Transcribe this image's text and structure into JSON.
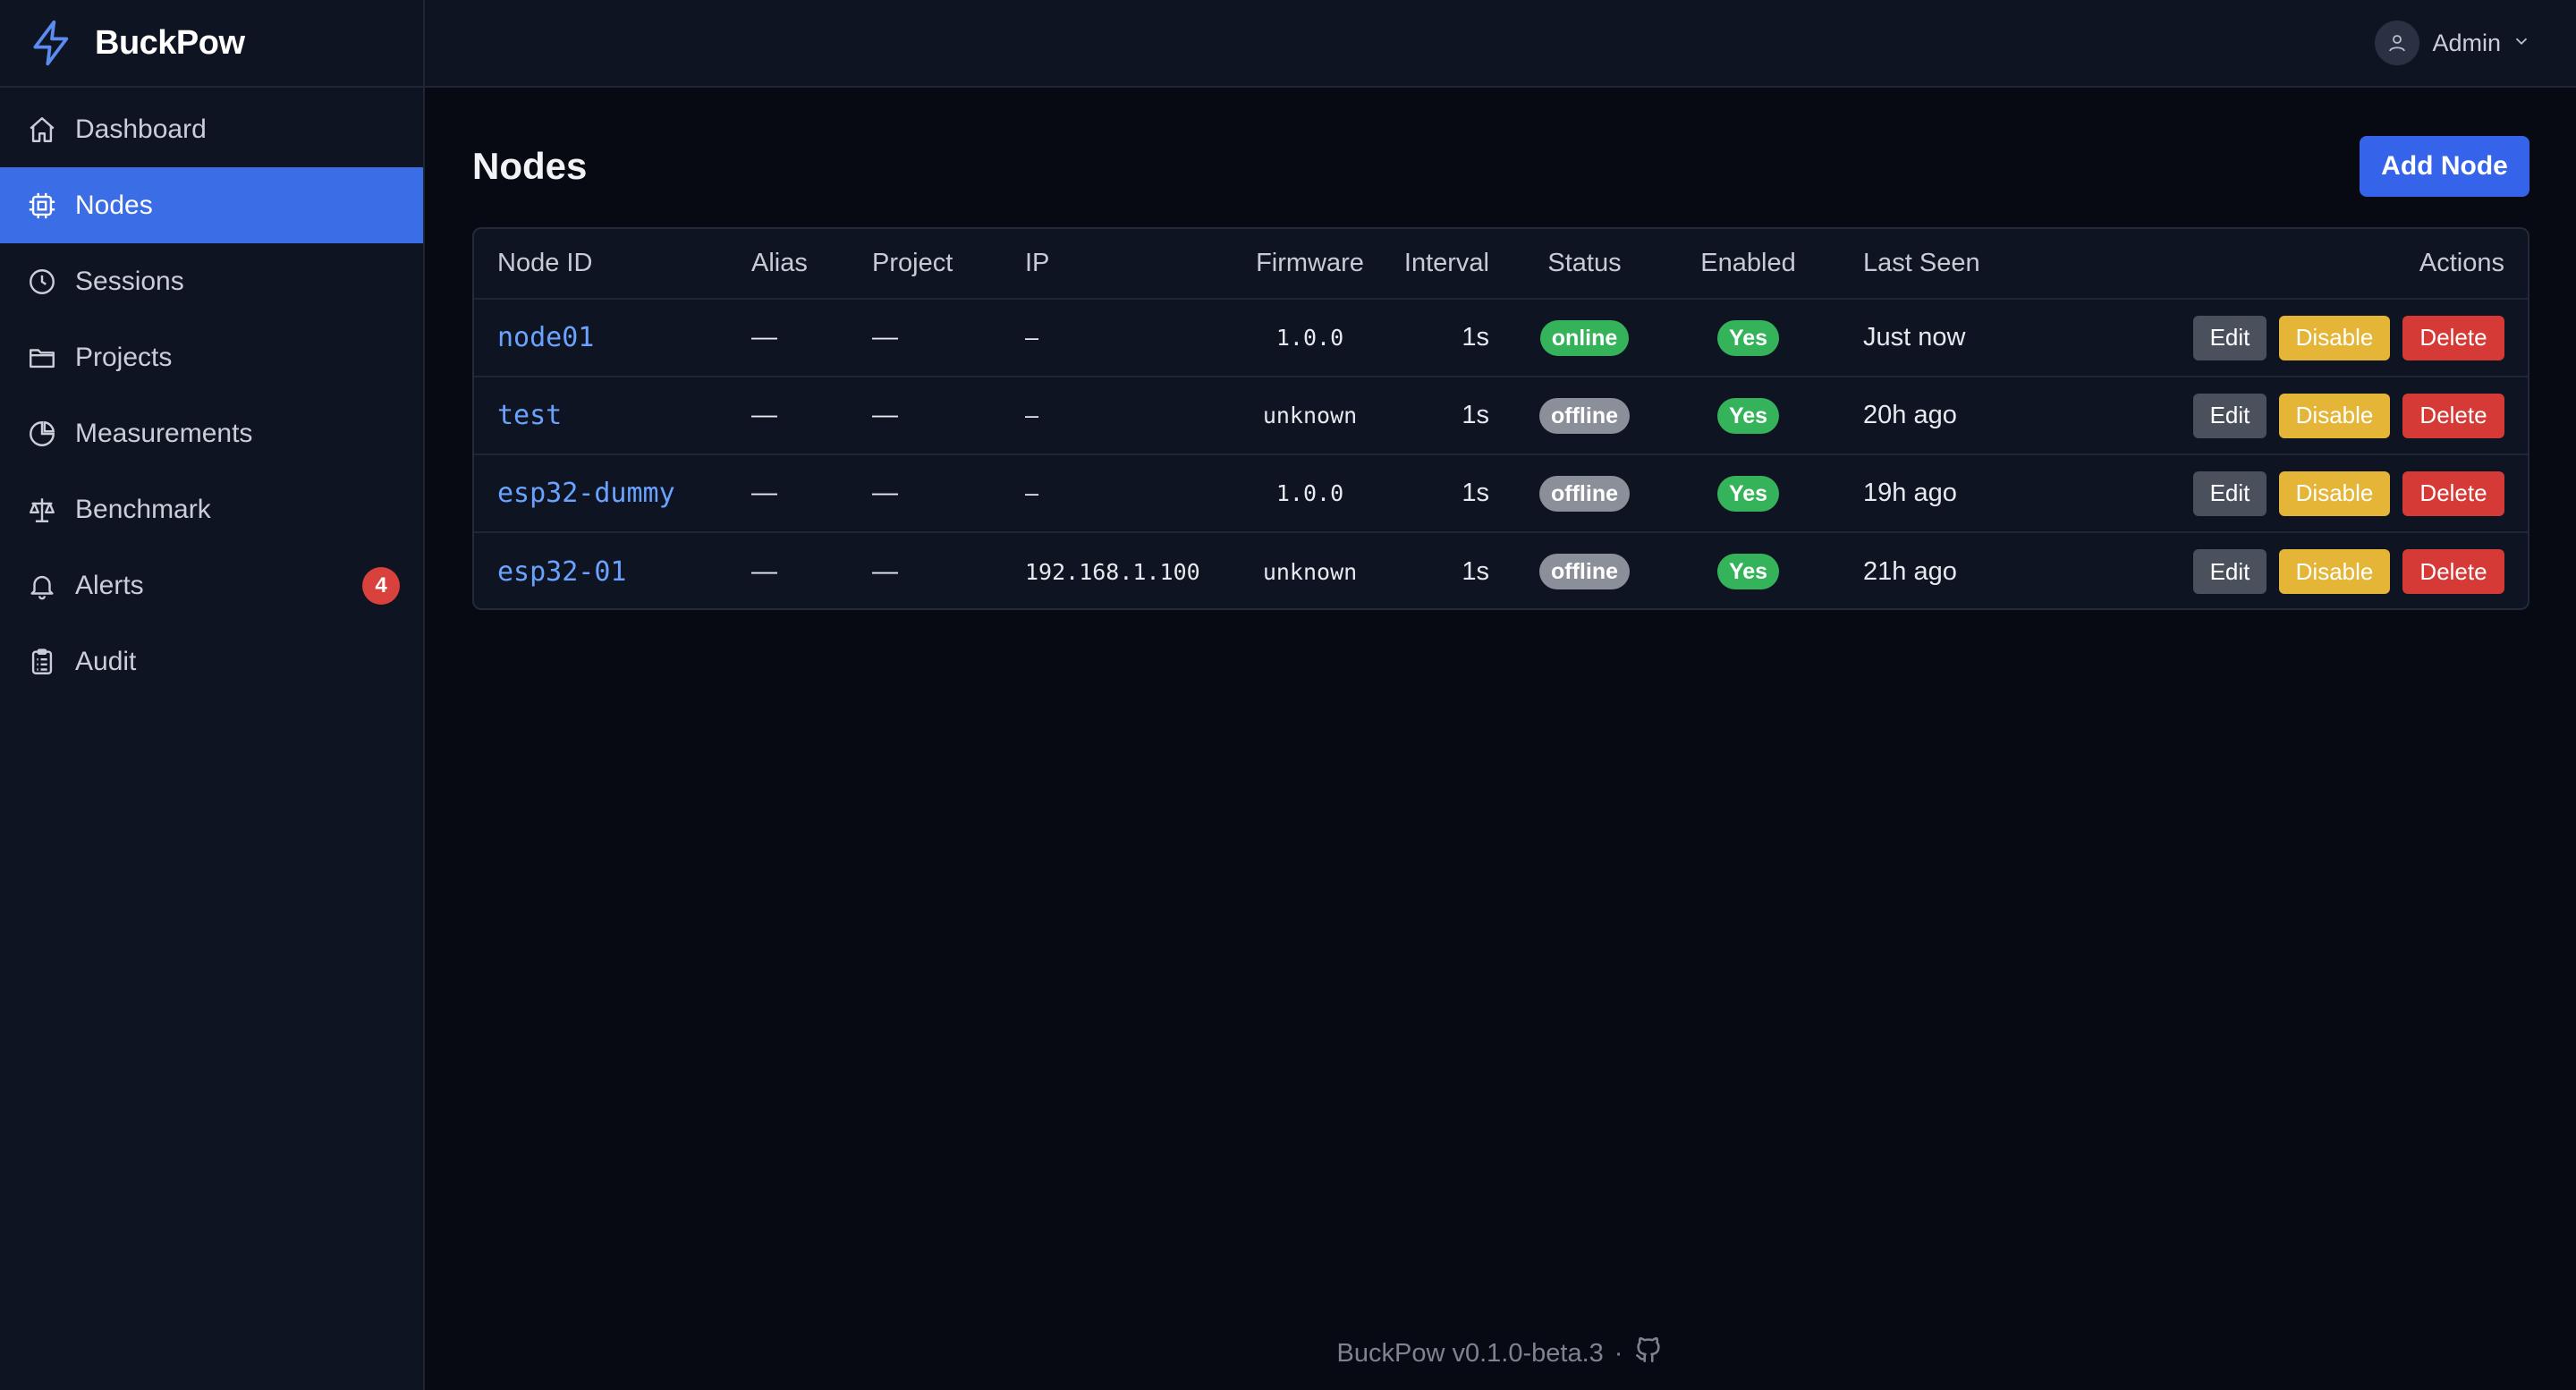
{
  "brand": {
    "name": "BuckPow",
    "icon": "bolt-icon"
  },
  "sidebar": {
    "items": [
      {
        "label": "Dashboard",
        "icon": "home-icon",
        "active": false
      },
      {
        "label": "Nodes",
        "icon": "chip-icon",
        "active": true
      },
      {
        "label": "Sessions",
        "icon": "clock-icon",
        "active": false
      },
      {
        "label": "Projects",
        "icon": "folder-icon",
        "active": false
      },
      {
        "label": "Measurements",
        "icon": "pie-chart-icon",
        "active": false
      },
      {
        "label": "Benchmark",
        "icon": "scale-icon",
        "active": false
      },
      {
        "label": "Alerts",
        "icon": "bell-icon",
        "active": false,
        "badge": "4"
      },
      {
        "label": "Audit",
        "icon": "clipboard-icon",
        "active": false
      }
    ]
  },
  "topbar": {
    "user_name": "Admin",
    "avatar_icon": "user-icon",
    "chevron_icon": "chevron-down-icon"
  },
  "main": {
    "title": "Nodes",
    "add_button": "Add Node",
    "columns": [
      "Node ID",
      "Alias",
      "Project",
      "IP",
      "Firmware",
      "Interval",
      "Status",
      "Enabled",
      "Last Seen",
      "Actions"
    ],
    "rows": [
      {
        "node_id": "node01",
        "alias": "—",
        "project": "—",
        "ip": "–",
        "firmware": "1.0.0",
        "interval": "1s",
        "status": "online",
        "enabled": "Yes",
        "last_seen": "Just now",
        "edit": "Edit",
        "disable": "Disable",
        "delete": "Delete"
      },
      {
        "node_id": "test",
        "alias": "—",
        "project": "—",
        "ip": "–",
        "firmware": "unknown",
        "interval": "1s",
        "status": "offline",
        "enabled": "Yes",
        "last_seen": "20h ago",
        "edit": "Edit",
        "disable": "Disable",
        "delete": "Delete"
      },
      {
        "node_id": "esp32-dummy",
        "alias": "—",
        "project": "—",
        "ip": "–",
        "firmware": "1.0.0",
        "interval": "1s",
        "status": "offline",
        "enabled": "Yes",
        "last_seen": "19h ago",
        "edit": "Edit",
        "disable": "Disable",
        "delete": "Delete"
      },
      {
        "node_id": "esp32-01",
        "alias": "—",
        "project": "—",
        "ip": "192.168.1.100",
        "firmware": "unknown",
        "interval": "1s",
        "status": "offline",
        "enabled": "Yes",
        "last_seen": "21h ago",
        "edit": "Edit",
        "disable": "Disable",
        "delete": "Delete"
      }
    ]
  },
  "footer": {
    "text": "BuckPow v0.1.0-beta.3",
    "separator": "·",
    "icon": "github-icon"
  },
  "colors": {
    "accent": "#3563e9",
    "online": "#35b35a",
    "offline": "#8a8f99",
    "warning": "#e4b536",
    "danger": "#d53a36",
    "link": "#6aa3ff"
  }
}
